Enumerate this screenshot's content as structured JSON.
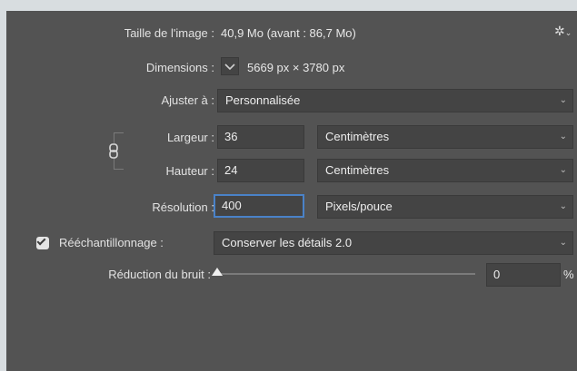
{
  "image_size": {
    "label": "Taille de l'image :",
    "value": "40,9 Mo (avant : 86,7 Mo)"
  },
  "dimensions": {
    "label": "Dimensions :",
    "value": "5669 px  ×  3780 px"
  },
  "fit_to": {
    "label": "Ajuster à :",
    "value": "Personnalisée"
  },
  "width": {
    "label": "Largeur :",
    "value": "36",
    "unit": "Centimètres"
  },
  "height": {
    "label": "Hauteur :",
    "value": "24",
    "unit": "Centimètres"
  },
  "resolution": {
    "label": "Résolution :",
    "value": "400",
    "unit": "Pixels/pouce"
  },
  "resample": {
    "label": "Rééchantillonnage :",
    "checked": true,
    "value": "Conserver les détails 2.0"
  },
  "noise_reduction": {
    "label": "Réduction du bruit :",
    "value": "0",
    "unit": "%",
    "level": 0
  },
  "icons": {
    "settings": "gear-icon",
    "link": "chain-link-icon",
    "chevron": "chevron-down-icon"
  },
  "colors": {
    "panel_bg": "#535353",
    "field_bg": "#444444",
    "focus_border": "#4a82c8"
  }
}
